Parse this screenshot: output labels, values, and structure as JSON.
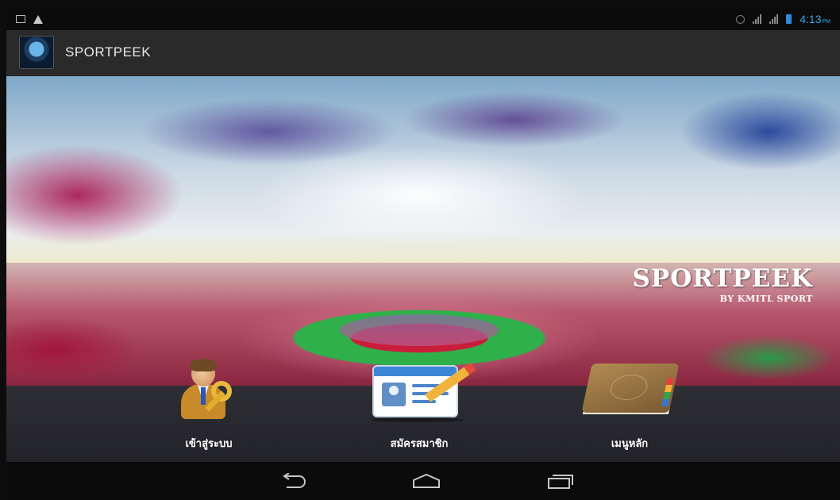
{
  "status_bar": {
    "time": "4:13",
    "am_pm": "PM",
    "icons": [
      "image-notification-icon",
      "warning-icon",
      "alarm-icon",
      "signal-icon",
      "signal-icon",
      "battery-icon"
    ],
    "colors": {
      "time": "#39a4e8",
      "battery": "#2f8ad8"
    }
  },
  "action_bar": {
    "title": "SPORTPEEK",
    "icon": "app-logo-icon"
  },
  "banner": {
    "brand_title": "SPORTPEEK",
    "brand_subtitle": "BY KMITL SPORT"
  },
  "menu": {
    "items": [
      {
        "label": "เข้าสู่ระบบ",
        "icon": "login-key-user-icon"
      },
      {
        "label": "สมัครสมาชิก",
        "icon": "id-card-pencil-icon"
      },
      {
        "label": "เมนูหลัก",
        "icon": "book-icon"
      }
    ]
  },
  "nav_bar": {
    "buttons": [
      "back-icon",
      "home-icon",
      "recents-icon"
    ]
  }
}
